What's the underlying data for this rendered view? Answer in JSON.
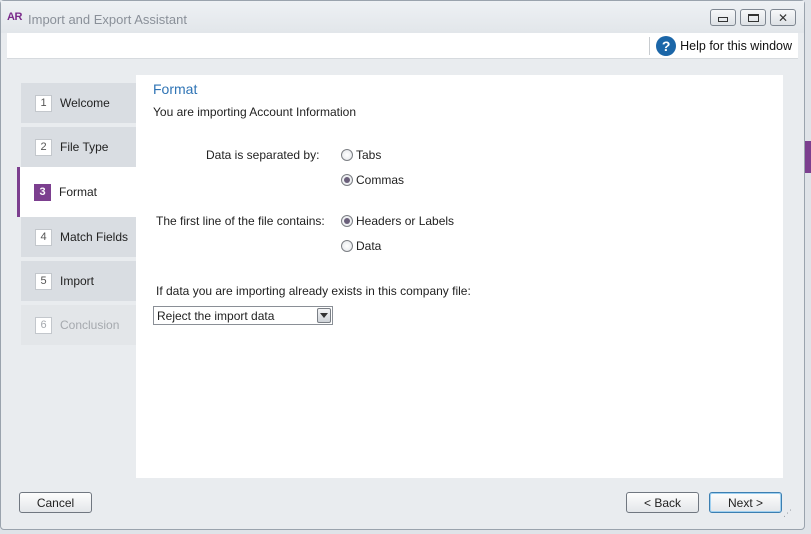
{
  "window": {
    "logo_text": "AR",
    "title": "Import and Export Assistant",
    "controls": {
      "minimize_icon": "minimize-icon",
      "maximize_icon": "maximize-icon",
      "close_glyph": "✕"
    }
  },
  "help": {
    "icon_glyph": "?",
    "label": "Help for this window"
  },
  "steps": [
    {
      "num": "1",
      "label": "Welcome"
    },
    {
      "num": "2",
      "label": "File Type"
    },
    {
      "num": "3",
      "label": "Format"
    },
    {
      "num": "4",
      "label": "Match Fields"
    },
    {
      "num": "5",
      "label": "Import"
    },
    {
      "num": "6",
      "label": "Conclusion"
    }
  ],
  "content": {
    "title": "Format",
    "subtitle": "You are importing Account Information",
    "separator": {
      "label": "Data is separated by:",
      "options": [
        {
          "label": "Tabs",
          "checked": false
        },
        {
          "label": "Commas",
          "checked": true
        }
      ]
    },
    "first_line": {
      "label": "The first line of the file contains:",
      "options": [
        {
          "label": "Headers or Labels",
          "checked": true
        },
        {
          "label": "Data",
          "checked": false
        }
      ]
    },
    "existing": {
      "label": "If data you are importing already exists in this company file:",
      "selected": "Reject the import data"
    }
  },
  "buttons": {
    "cancel": "Cancel",
    "back": "< Back",
    "next": "Next >"
  },
  "colors": {
    "accent": "#7c3f8f",
    "title_blue": "#2f74b5"
  }
}
